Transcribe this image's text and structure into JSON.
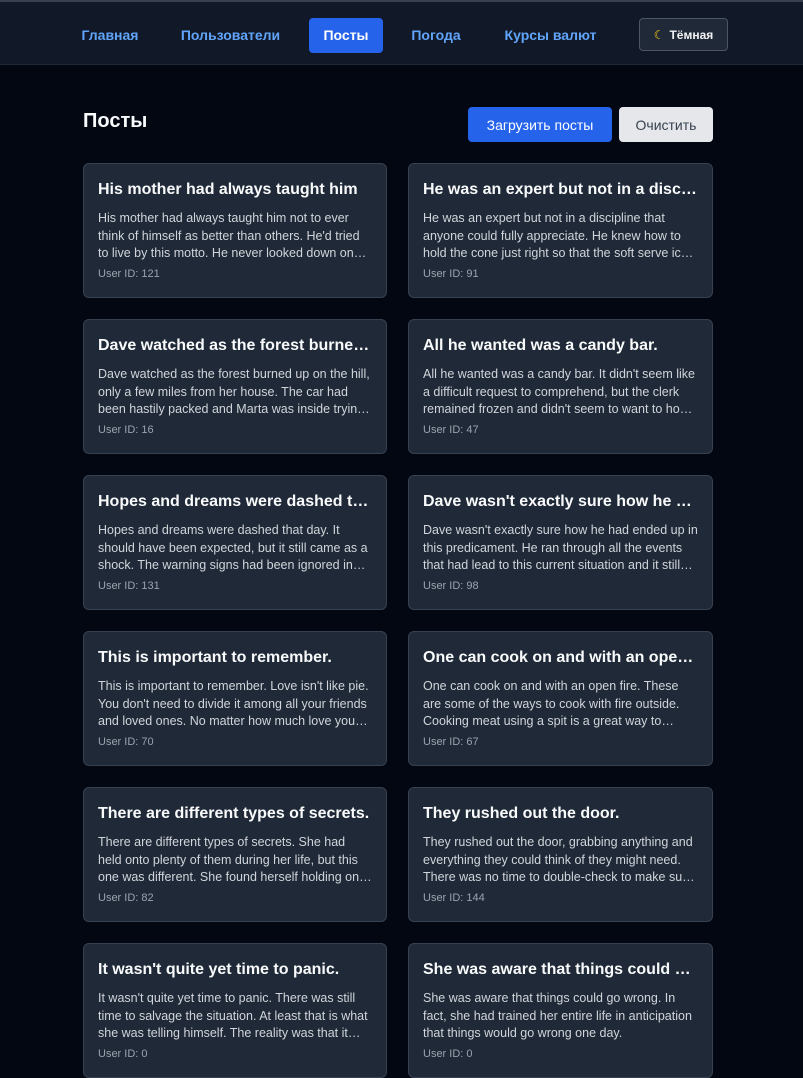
{
  "nav": {
    "items": [
      "Главная",
      "Пользователи",
      "Посты",
      "Погода",
      "Курсы валют"
    ],
    "active_index": 2,
    "theme_label": "Тёмная",
    "theme_icon": "moon-icon"
  },
  "page": {
    "title": "Посты",
    "load_button": "Загрузить посты",
    "clear_button": "Очистить"
  },
  "user_prefix": "User ID: ",
  "posts": [
    {
      "title": "His mother had always taught him",
      "body": "His mother had always taught him not to ever think of himself as better than others. He'd tried to live by this motto. He never looked down on those who were less fortunate or who had less money than him.",
      "user_id": 121
    },
    {
      "title": "He was an expert but not in a discipline",
      "body": "He was an expert but not in a discipline that anyone could fully appreciate. He knew how to hold the cone just right so that the soft serve ice cream fell into it at the precise angle.",
      "user_id": 91
    },
    {
      "title": "Dave watched as the forest burned up on the hill.",
      "body": "Dave watched as the forest burned up on the hill, only a few miles from her house. The car had been hastily packed and Marta was inside trying to round up the last of the pets.",
      "user_id": 16
    },
    {
      "title": "All he wanted was a candy bar.",
      "body": "All he wanted was a candy bar. It didn't seem like a difficult request to comprehend, but the clerk remained frozen and didn't seem to want to honor the request.",
      "user_id": 47
    },
    {
      "title": "Hopes and dreams were dashed that day.",
      "body": "Hopes and dreams were dashed that day. It should have been expected, but it still came as a shock. The warning signs had been ignored in favor of the possibility, however remote, that it could actually happen.",
      "user_id": 131
    },
    {
      "title": "Dave wasn't exactly sure how he had ended up",
      "body": "Dave wasn't exactly sure how he had ended up in this predicament. He ran through all the events that had lead to this current situation and it still didn't make sense.",
      "user_id": 98
    },
    {
      "title": "This is important to remember.",
      "body": "This is important to remember. Love isn't like pie. You don't need to divide it among all your friends and loved ones. No matter how much love you give, you can always give more.",
      "user_id": 70
    },
    {
      "title": "One can cook on and with an open fire.",
      "body": "One can cook on and with an open fire. These are some of the ways to cook with fire outside. Cooking meat using a spit is a great way to evenly cook meat.",
      "user_id": 67
    },
    {
      "title": "There are different types of secrets.",
      "body": "There are different types of secrets. She had held onto plenty of them during her life, but this one was different. She found herself holding onto the worst type.",
      "user_id": 82
    },
    {
      "title": "They rushed out the door.",
      "body": "They rushed out the door, grabbing anything and everything they could think of they might need. There was no time to double-check to make sure they weren't leaving something important behind.",
      "user_id": 144
    },
    {
      "title": "It wasn't quite yet time to panic.",
      "body": "It wasn't quite yet time to panic. There was still time to salvage the situation. At least that is what she was telling himself. The reality was that it was time to panic.",
      "user_id": 0
    },
    {
      "title": "She was aware that things could go wrong.",
      "body": "She was aware that things could go wrong. In fact, she had trained her entire life in anticipation that things would go wrong one day.",
      "user_id": 0
    }
  ]
}
